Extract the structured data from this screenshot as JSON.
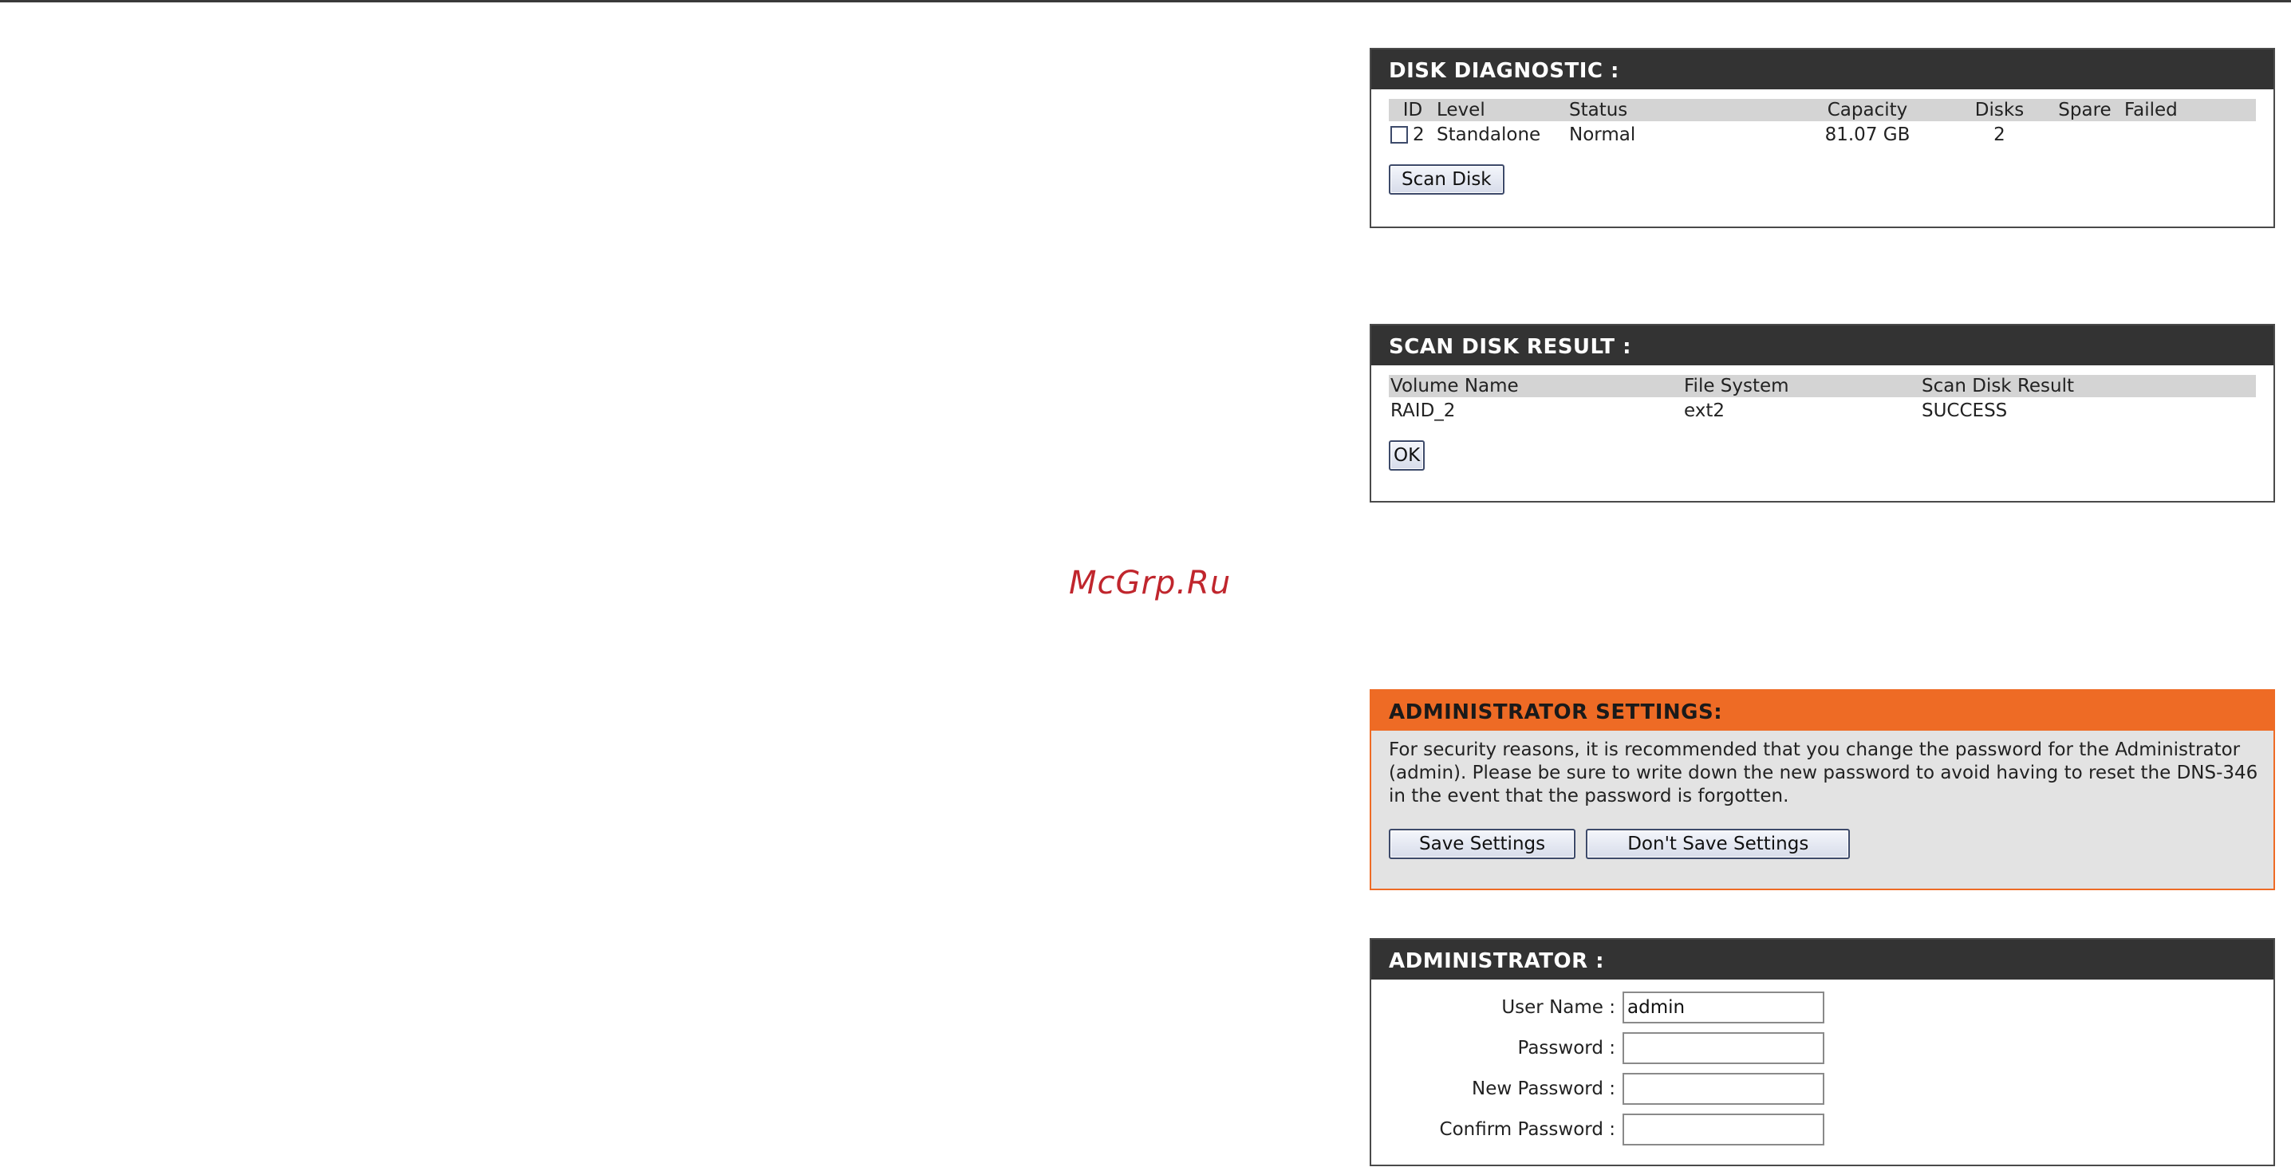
{
  "watermark": "McGrp.Ru",
  "disk_diagnostic": {
    "title": "DISK DIAGNOSTIC :",
    "columns": [
      "ID",
      "Level",
      "Status",
      "Capacity",
      "Disks",
      "Spare",
      "Failed"
    ],
    "rows": [
      {
        "id": "2",
        "level": "Standalone",
        "status": "Normal",
        "capacity": "81.07 GB",
        "disks": "2",
        "spare": "",
        "failed": "",
        "checked": false
      }
    ],
    "scan_button": "Scan Disk"
  },
  "scan_disk_result": {
    "title": "SCAN DISK RESULT :",
    "columns": [
      "Volume Name",
      "File System",
      "Scan Disk Result"
    ],
    "rows": [
      {
        "volume_name": "RAID_2",
        "file_system": "ext2",
        "result": "SUCCESS"
      }
    ],
    "ok_button": "OK"
  },
  "administrator_settings": {
    "title": "ADMINISTRATOR SETTINGS:",
    "description": "For security reasons, it is recommended that you change the password for the Administrator (admin). Please be sure to write down the new password to avoid having to reset the DNS-346 in the event that the password is forgotten.",
    "save_button": "Save Settings",
    "dont_save_button": "Don't Save Settings",
    "accent_color": "#ee6b25"
  },
  "administrator": {
    "title": "ADMINISTRATOR :",
    "fields": {
      "user_name": {
        "label": "User Name :",
        "value": "admin"
      },
      "password": {
        "label": "Password :",
        "value": ""
      },
      "new_password": {
        "label": "New Password :",
        "value": ""
      },
      "confirm_password": {
        "label": "Confirm Password :",
        "value": ""
      }
    }
  }
}
